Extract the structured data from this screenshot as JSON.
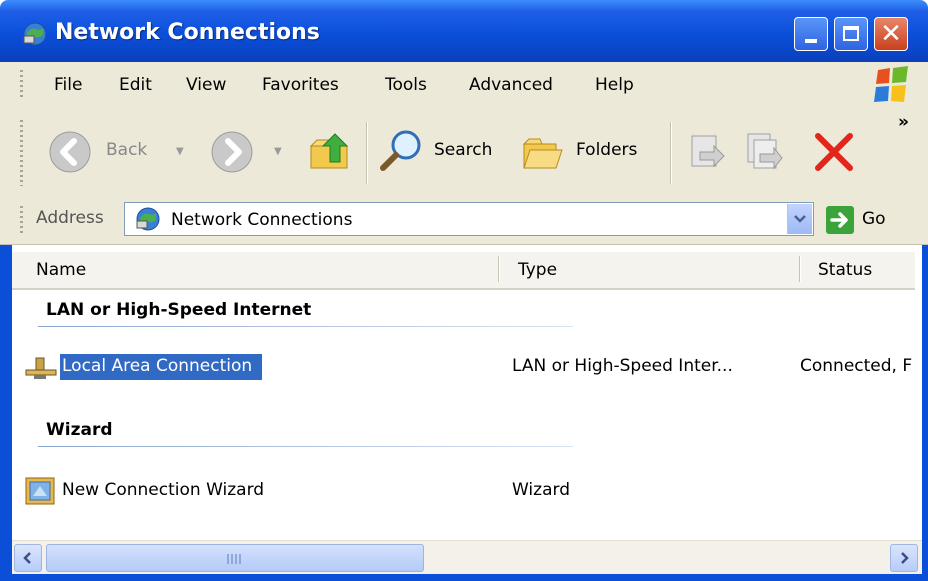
{
  "window": {
    "title": "Network Connections"
  },
  "menu": [
    "File",
    "Edit",
    "View",
    "Favorites",
    "Tools",
    "Advanced",
    "Help"
  ],
  "toolbar": {
    "back_label": "Back",
    "search_label": "Search",
    "folders_label": "Folders",
    "overflow": "»"
  },
  "address": {
    "label": "Address",
    "value": "Network Connections",
    "go_label": "Go"
  },
  "columns": {
    "name": "Name",
    "type": "Type",
    "status": "Status"
  },
  "groups": [
    {
      "title": "LAN or High-Speed Internet",
      "items": [
        {
          "name": "Local Area Connection",
          "type": "LAN or High-Speed Inter...",
          "status": "Connected, F"
        }
      ]
    },
    {
      "title": "Wizard",
      "items": [
        {
          "name": "New Connection Wizard",
          "type": "Wizard",
          "status": ""
        }
      ]
    }
  ],
  "colors": {
    "titlebar": "#0b4fd9",
    "selection": "#316ac5",
    "chrome": "#ece9d8"
  }
}
